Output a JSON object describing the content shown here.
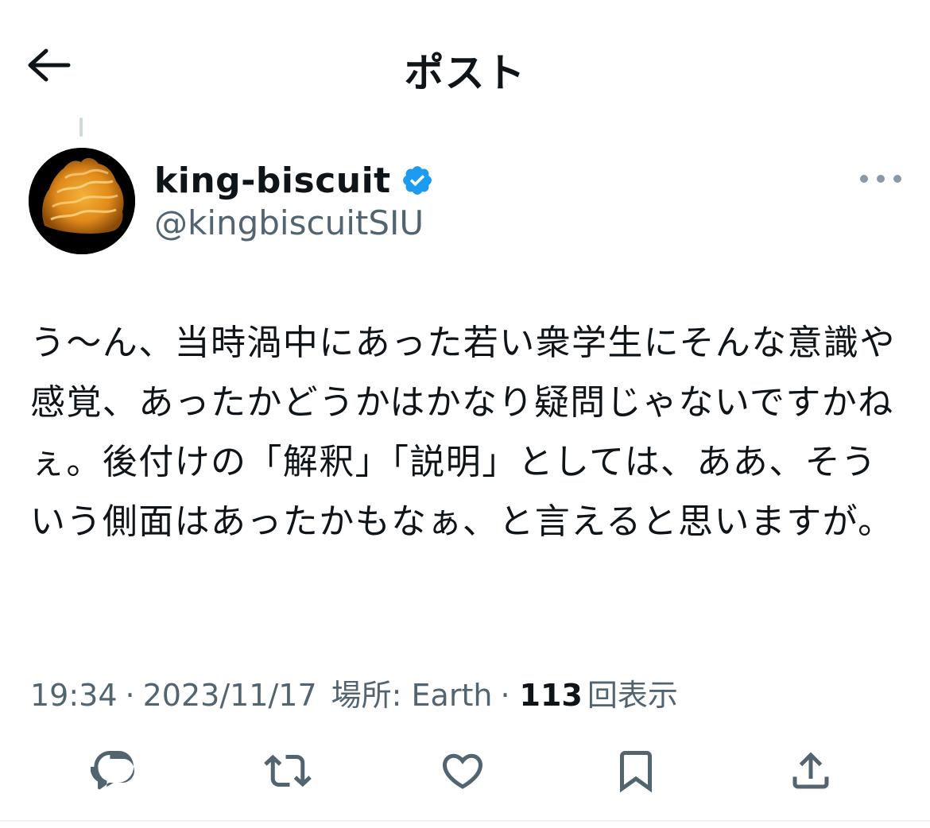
{
  "header": {
    "title": "ポスト",
    "back_icon": "arrow-left-icon"
  },
  "author": {
    "display_name": "king-biscuit",
    "handle": "@kingbiscuitSIU",
    "verified": true,
    "verified_color": "#1d9bf0"
  },
  "post": {
    "text": "う〜ん、当時渦中にあった若い衆学生にそんな意識や感覚、あったかどうかはかなり疑問じゃないですかねぇ。後付けの「解釈」「説明」としては、ああ、そういう側面はあったかもなぁ、と言えると思いますが。"
  },
  "meta": {
    "time": "19:34",
    "separator": "·",
    "date": "2023/11/17",
    "location": "場所: Earth",
    "views_count": "113",
    "views_label": "回表示"
  },
  "actions": [
    {
      "name": "reply",
      "icon": "reply-icon"
    },
    {
      "name": "repost",
      "icon": "repost-icon"
    },
    {
      "name": "like",
      "icon": "heart-icon"
    },
    {
      "name": "bookmark",
      "icon": "bookmark-icon"
    },
    {
      "name": "share",
      "icon": "share-icon"
    }
  ],
  "colors": {
    "text_primary": "#0f1419",
    "text_secondary": "#536471",
    "icon_gray": "#536471",
    "accent": "#1d9bf0"
  }
}
